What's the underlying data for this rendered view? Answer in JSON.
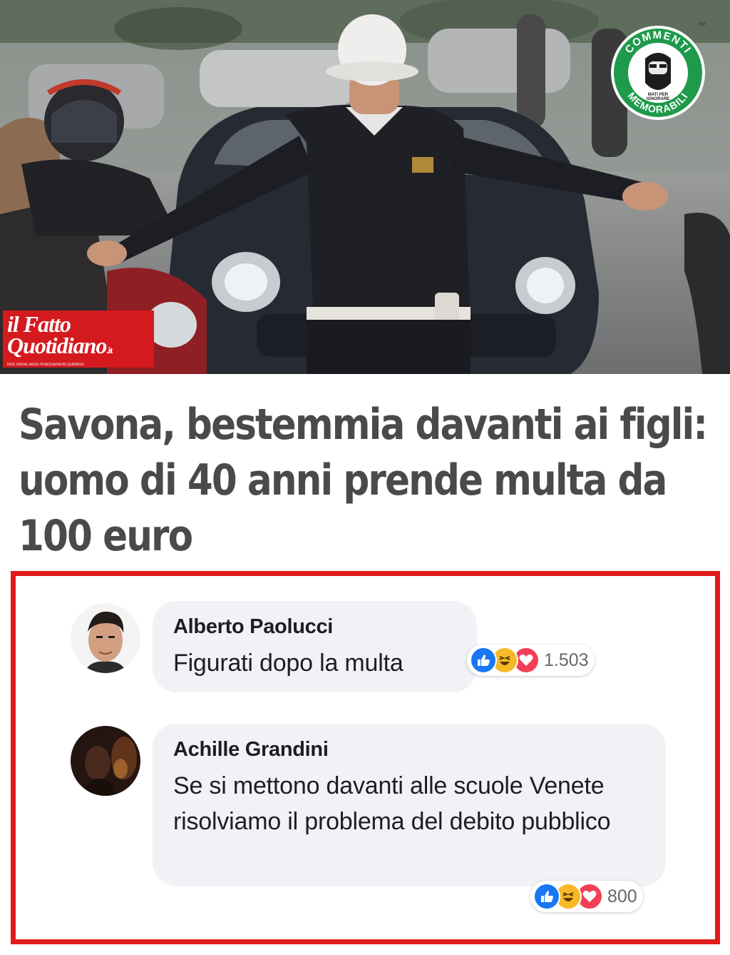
{
  "hero": {
    "publisher_logo": {
      "line1": "il Fatto",
      "line2": "Quotidiano",
      "suffix": ".it",
      "tagline": "Non riceve alcun finanziamento pubblico"
    },
    "badge": {
      "top_text": "COMMENTI",
      "bottom_text": "MEMORABILI",
      "center_text_1": "MATI PER",
      "center_text_2": "IGNORARE",
      "mark": "TM"
    }
  },
  "headline": "Savona, bestemmia davanti ai figli: uomo di 40 anni prende multa da 100 euro",
  "comments": [
    {
      "author": "Alberto Paolucci",
      "text": "Figurati dopo la multa",
      "reactions": [
        "like",
        "haha",
        "love"
      ],
      "reaction_count": "1.503"
    },
    {
      "author": "Achille Grandini",
      "text": "Se si mettono davanti alle scuole Venete risolviamo il problema del debito pubblico",
      "reactions": [
        "like",
        "haha",
        "love"
      ],
      "reaction_count": "800"
    }
  ],
  "colors": {
    "frame_border": "#e01b1b",
    "fatto_red": "#d41a1f",
    "badge_green": "#1e9a4a",
    "bubble_bg": "#f0f2f5",
    "like_blue": "#1877f2",
    "haha_yellow": "#f7b928",
    "love_red": "#f33e58"
  }
}
